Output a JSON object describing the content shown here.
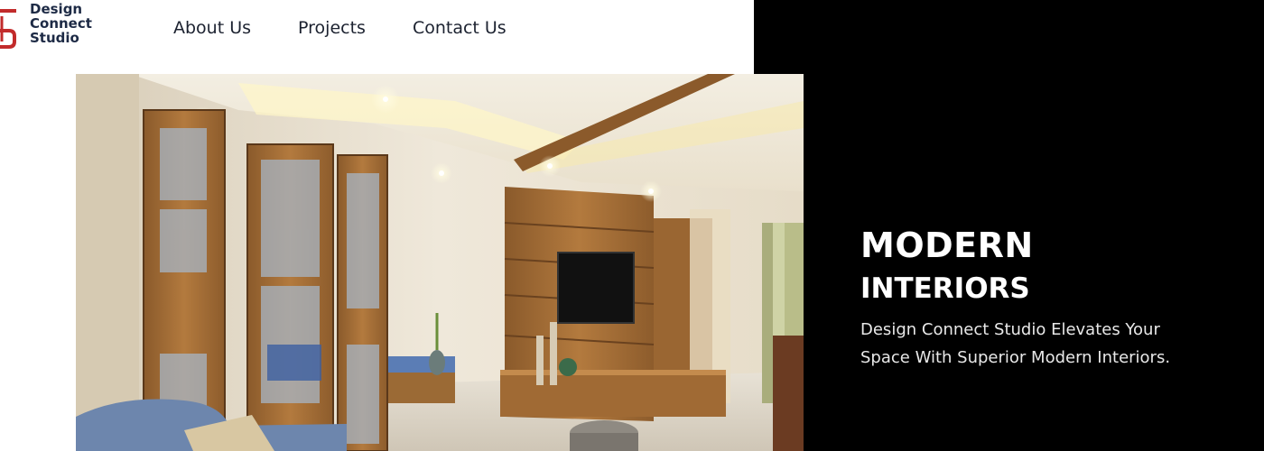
{
  "brand": {
    "name_lines": [
      "Design",
      "Connect",
      "Studio"
    ],
    "colors": {
      "mark": "#c22b2b",
      "text": "#1d2a45"
    }
  },
  "nav": {
    "items": [
      {
        "label": "About Us"
      },
      {
        "label": "Projects"
      },
      {
        "label": "Contact Us"
      }
    ]
  },
  "hero": {
    "title": "MODERN",
    "subtitle": "INTERIORS",
    "description": "Design Connect Studio Elevates Your Space With Superior Modern Interiors.",
    "image_subject": "modern living room interior with wooden partition and TV unit"
  }
}
